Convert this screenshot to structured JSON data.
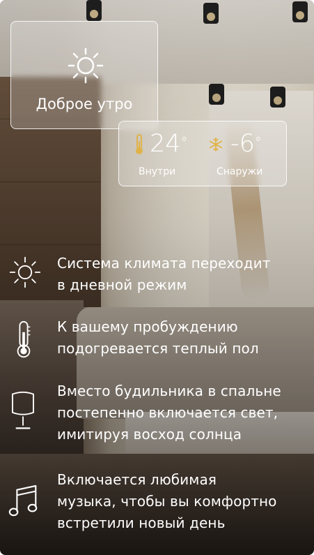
{
  "greeting": {
    "label": "Доброе утро",
    "icon": "sun-icon"
  },
  "temperature": {
    "inside": {
      "value": "24",
      "unit": "°",
      "label": "Внутри",
      "icon": "thermometer-icon",
      "icon_color": "#e0b34a"
    },
    "outside": {
      "value": "-6",
      "unit": "°",
      "label": "Снаружи",
      "icon": "snowflake-icon",
      "icon_color": "#e0b34a"
    }
  },
  "features": [
    {
      "icon": "sun-icon",
      "text": "Система климата переходит в дневной режим",
      "lines": [
        "Система климата переходит",
        "в дневной режим"
      ]
    },
    {
      "icon": "thermometer-icon",
      "text": "К вашему пробуждению подогревается теплый пол",
      "lines": [
        "К вашему пробуждению",
        "подогревается теплый пол"
      ]
    },
    {
      "icon": "lamp-icon",
      "text": "Вместо будильника в спальне постепенно включается свет, имитируя восход солнца",
      "lines": [
        "Вместо будильника в спальне",
        "постепенно включается свет,",
        "имитируя восход солнца"
      ]
    },
    {
      "icon": "music-note-icon",
      "text": "Включается любимая музыка, чтобы вы комфортно встретили новый день",
      "lines": [
        "Включается любимая",
        "музыка, чтобы вы комфортно",
        "встретили новый день"
      ]
    }
  ],
  "colors": {
    "text": "#ffffff",
    "accent": "#e0b34a",
    "card_border": "#ffffff"
  }
}
